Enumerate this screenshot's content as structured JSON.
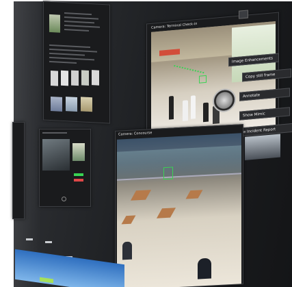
{
  "cameras": {
    "terminal_title": "Camera: Terminal Check-in",
    "concourse_title": "Camera: Concourse"
  },
  "context_menu": {
    "items": [
      "Image Enhancements",
      "Copy still frame",
      "Annotate",
      "Show Mimic",
      "Create Incident Report"
    ]
  },
  "colors": {
    "wall": "#1f2124",
    "panel": "#1a1b1d",
    "highlight": "#39d353",
    "taskbar": "#3d7fd0"
  }
}
